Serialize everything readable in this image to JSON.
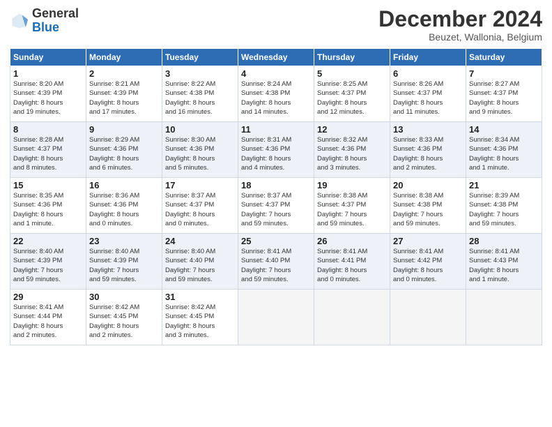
{
  "header": {
    "logo_line1": "General",
    "logo_line2": "Blue",
    "month_title": "December 2024",
    "location": "Beuzet, Wallonia, Belgium"
  },
  "weekdays": [
    "Sunday",
    "Monday",
    "Tuesday",
    "Wednesday",
    "Thursday",
    "Friday",
    "Saturday"
  ],
  "weeks": [
    [
      {
        "day": "1",
        "lines": [
          "Sunrise: 8:20 AM",
          "Sunset: 4:39 PM",
          "Daylight: 8 hours",
          "and 19 minutes."
        ]
      },
      {
        "day": "2",
        "lines": [
          "Sunrise: 8:21 AM",
          "Sunset: 4:39 PM",
          "Daylight: 8 hours",
          "and 17 minutes."
        ]
      },
      {
        "day": "3",
        "lines": [
          "Sunrise: 8:22 AM",
          "Sunset: 4:38 PM",
          "Daylight: 8 hours",
          "and 16 minutes."
        ]
      },
      {
        "day": "4",
        "lines": [
          "Sunrise: 8:24 AM",
          "Sunset: 4:38 PM",
          "Daylight: 8 hours",
          "and 14 minutes."
        ]
      },
      {
        "day": "5",
        "lines": [
          "Sunrise: 8:25 AM",
          "Sunset: 4:37 PM",
          "Daylight: 8 hours",
          "and 12 minutes."
        ]
      },
      {
        "day": "6",
        "lines": [
          "Sunrise: 8:26 AM",
          "Sunset: 4:37 PM",
          "Daylight: 8 hours",
          "and 11 minutes."
        ]
      },
      {
        "day": "7",
        "lines": [
          "Sunrise: 8:27 AM",
          "Sunset: 4:37 PM",
          "Daylight: 8 hours",
          "and 9 minutes."
        ]
      }
    ],
    [
      {
        "day": "8",
        "lines": [
          "Sunrise: 8:28 AM",
          "Sunset: 4:37 PM",
          "Daylight: 8 hours",
          "and 8 minutes."
        ]
      },
      {
        "day": "9",
        "lines": [
          "Sunrise: 8:29 AM",
          "Sunset: 4:36 PM",
          "Daylight: 8 hours",
          "and 6 minutes."
        ]
      },
      {
        "day": "10",
        "lines": [
          "Sunrise: 8:30 AM",
          "Sunset: 4:36 PM",
          "Daylight: 8 hours",
          "and 5 minutes."
        ]
      },
      {
        "day": "11",
        "lines": [
          "Sunrise: 8:31 AM",
          "Sunset: 4:36 PM",
          "Daylight: 8 hours",
          "and 4 minutes."
        ]
      },
      {
        "day": "12",
        "lines": [
          "Sunrise: 8:32 AM",
          "Sunset: 4:36 PM",
          "Daylight: 8 hours",
          "and 3 minutes."
        ]
      },
      {
        "day": "13",
        "lines": [
          "Sunrise: 8:33 AM",
          "Sunset: 4:36 PM",
          "Daylight: 8 hours",
          "and 2 minutes."
        ]
      },
      {
        "day": "14",
        "lines": [
          "Sunrise: 8:34 AM",
          "Sunset: 4:36 PM",
          "Daylight: 8 hours",
          "and 1 minute."
        ]
      }
    ],
    [
      {
        "day": "15",
        "lines": [
          "Sunrise: 8:35 AM",
          "Sunset: 4:36 PM",
          "Daylight: 8 hours",
          "and 1 minute."
        ]
      },
      {
        "day": "16",
        "lines": [
          "Sunrise: 8:36 AM",
          "Sunset: 4:36 PM",
          "Daylight: 8 hours",
          "and 0 minutes."
        ]
      },
      {
        "day": "17",
        "lines": [
          "Sunrise: 8:37 AM",
          "Sunset: 4:37 PM",
          "Daylight: 8 hours",
          "and 0 minutes."
        ]
      },
      {
        "day": "18",
        "lines": [
          "Sunrise: 8:37 AM",
          "Sunset: 4:37 PM",
          "Daylight: 7 hours",
          "and 59 minutes."
        ]
      },
      {
        "day": "19",
        "lines": [
          "Sunrise: 8:38 AM",
          "Sunset: 4:37 PM",
          "Daylight: 7 hours",
          "and 59 minutes."
        ]
      },
      {
        "day": "20",
        "lines": [
          "Sunrise: 8:38 AM",
          "Sunset: 4:38 PM",
          "Daylight: 7 hours",
          "and 59 minutes."
        ]
      },
      {
        "day": "21",
        "lines": [
          "Sunrise: 8:39 AM",
          "Sunset: 4:38 PM",
          "Daylight: 7 hours",
          "and 59 minutes."
        ]
      }
    ],
    [
      {
        "day": "22",
        "lines": [
          "Sunrise: 8:40 AM",
          "Sunset: 4:39 PM",
          "Daylight: 7 hours",
          "and 59 minutes."
        ]
      },
      {
        "day": "23",
        "lines": [
          "Sunrise: 8:40 AM",
          "Sunset: 4:39 PM",
          "Daylight: 7 hours",
          "and 59 minutes."
        ]
      },
      {
        "day": "24",
        "lines": [
          "Sunrise: 8:40 AM",
          "Sunset: 4:40 PM",
          "Daylight: 7 hours",
          "and 59 minutes."
        ]
      },
      {
        "day": "25",
        "lines": [
          "Sunrise: 8:41 AM",
          "Sunset: 4:40 PM",
          "Daylight: 7 hours",
          "and 59 minutes."
        ]
      },
      {
        "day": "26",
        "lines": [
          "Sunrise: 8:41 AM",
          "Sunset: 4:41 PM",
          "Daylight: 8 hours",
          "and 0 minutes."
        ]
      },
      {
        "day": "27",
        "lines": [
          "Sunrise: 8:41 AM",
          "Sunset: 4:42 PM",
          "Daylight: 8 hours",
          "and 0 minutes."
        ]
      },
      {
        "day": "28",
        "lines": [
          "Sunrise: 8:41 AM",
          "Sunset: 4:43 PM",
          "Daylight: 8 hours",
          "and 1 minute."
        ]
      }
    ],
    [
      {
        "day": "29",
        "lines": [
          "Sunrise: 8:41 AM",
          "Sunset: 4:44 PM",
          "Daylight: 8 hours",
          "and 2 minutes."
        ]
      },
      {
        "day": "30",
        "lines": [
          "Sunrise: 8:42 AM",
          "Sunset: 4:45 PM",
          "Daylight: 8 hours",
          "and 2 minutes."
        ]
      },
      {
        "day": "31",
        "lines": [
          "Sunrise: 8:42 AM",
          "Sunset: 4:45 PM",
          "Daylight: 8 hours",
          "and 3 minutes."
        ]
      },
      null,
      null,
      null,
      null
    ]
  ]
}
